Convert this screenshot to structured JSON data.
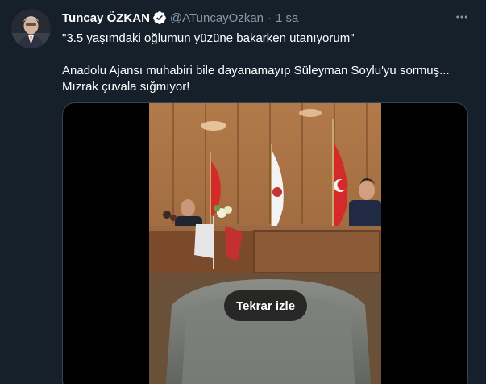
{
  "tweet": {
    "author_name": "Tuncay ÖZKAN",
    "handle": "@ATuncayOzkan",
    "separator": "·",
    "time": "1 sa",
    "verified_icon": "verified-badge-icon",
    "more_icon": "more-options-icon",
    "text_line1": "\"3.5 yaşımdaki oğlumun yüzüne bakarken utanıyorum\"",
    "text_line2": "Anadolu Ajansı muhabiri bile dayanamayıp Süleyman Soylu'yu sormuş...",
    "text_line3": "Mızrak çuvala sığmıyor!"
  },
  "media": {
    "replay_label": "Tekrar izle"
  },
  "colors": {
    "background": "#15202b",
    "text_primary": "#ffffff",
    "text_secondary": "#8899a6",
    "verified_blue": "#1da1f2",
    "border": "#38444d"
  }
}
